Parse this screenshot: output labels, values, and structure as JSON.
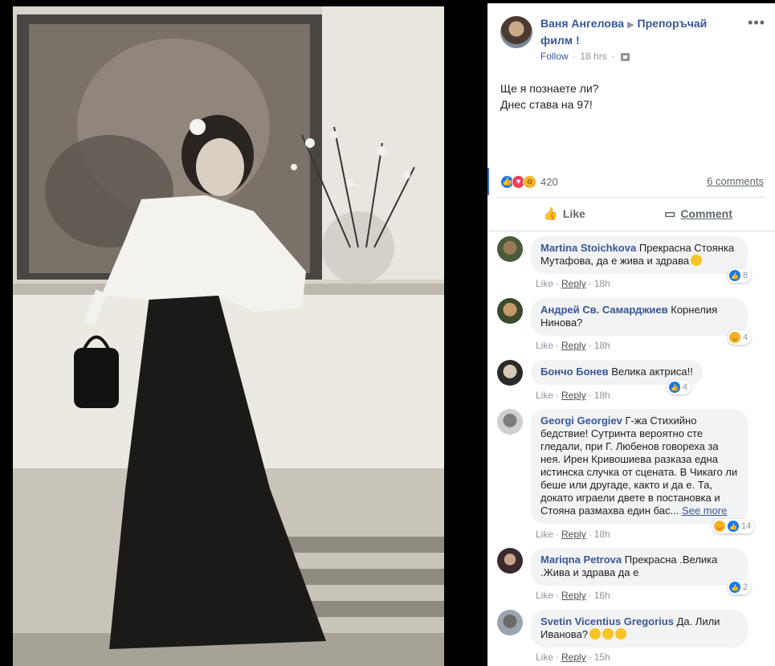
{
  "post": {
    "author": "Ваня Ангелова",
    "shared_to": "Препоръчай филм !",
    "follow_label": "Follow",
    "time": "18 hrs",
    "text_line1": "Ще я познаете ли?",
    "text_line2": "Днес става на 97!",
    "reaction_count": "420",
    "comments_count_label": "6 comments",
    "like_label": "Like",
    "comment_label": "Comment",
    "more_label": "•••"
  },
  "comments": [
    {
      "name": "Martina Stoichkova",
      "text": "Прекрасна Стоянка Мутафова, да е жива и здрава",
      "time": "18h",
      "reactions": "8",
      "reaction_type": "like"
    },
    {
      "name": "Андрей Св. Самарджиев",
      "text": "Корнелия Нинова?",
      "time": "18h",
      "reactions": "4",
      "reaction_type": "haha"
    },
    {
      "name": "Бончо Бонев",
      "text": "Велика актриса!!",
      "time": "18h",
      "reactions": "4",
      "reaction_type": "like"
    },
    {
      "name": "Georgi Georgiev",
      "text": "Г-жа Стихийно бедствие! Сутринта вероятно сте гледали, при Г. Любенов говореха за нея. Ирен Кривошиева разказа една истинска случка от сцената. В Чикаго ли беше или другаде, както и да е. Та, докато играели двете в постановка и Стояна размахва един бас...",
      "see_more": "See more",
      "time": "18h",
      "reactions": "14",
      "reaction_type": "haha-like"
    },
    {
      "name": "Mariqna Petrova",
      "text": "Прекрасна .Велика .Жива и здрава да е",
      "time": "16h",
      "reactions": "2",
      "reaction_type": "like"
    },
    {
      "name": "Svetin Vicentius Gregorius",
      "text": "Да. Лили Иванова?",
      "time": "15h",
      "reactions": "",
      "reaction_type": "none"
    }
  ],
  "comment_action_like": "Like",
  "comment_action_reply": "Reply",
  "colors": {
    "link_blue": "#385898",
    "facebook_blue": "#1877f2",
    "bubble_gray": "#f2f3f5",
    "photo_bg": "#000000"
  },
  "icons": [
    "more-icon",
    "privacy-icon",
    "like-thumb-icon",
    "comment-icon",
    "like-reaction-icon",
    "love-reaction-icon",
    "wow-reaction-icon",
    "haha-reaction-icon"
  ]
}
